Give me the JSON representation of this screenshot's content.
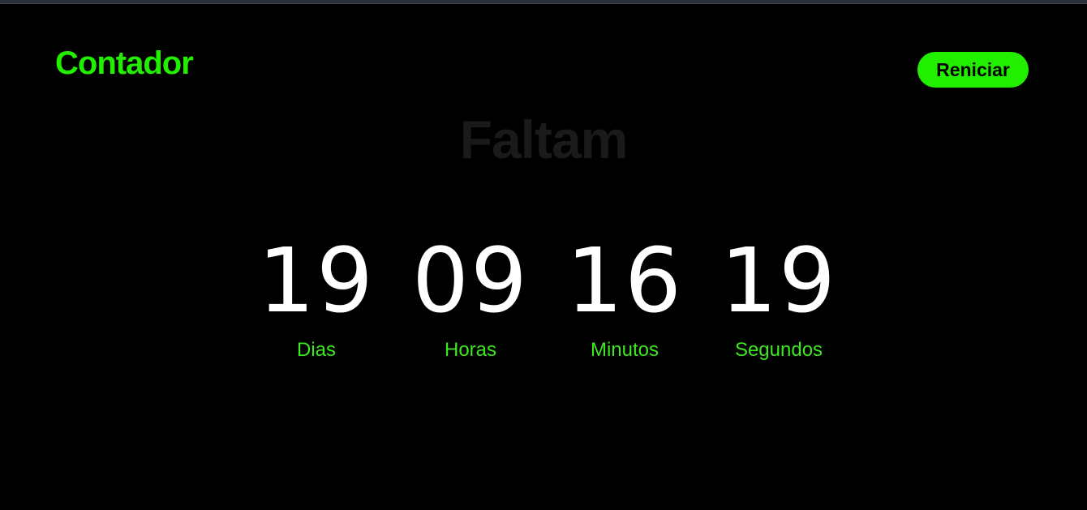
{
  "colors": {
    "background": "#000000",
    "accent": "#22ee00",
    "label": "#3ce81e",
    "heading": "#1a1a1a",
    "digits": "#ffffff"
  },
  "header": {
    "brand": "Contador",
    "restart_label": "Reniciar"
  },
  "main": {
    "heading": "Faltam",
    "units": [
      {
        "value": "19",
        "label": "Dias"
      },
      {
        "value": "09",
        "label": "Horas"
      },
      {
        "value": "16",
        "label": "Minutos"
      },
      {
        "value": "19",
        "label": "Segundos"
      }
    ]
  }
}
